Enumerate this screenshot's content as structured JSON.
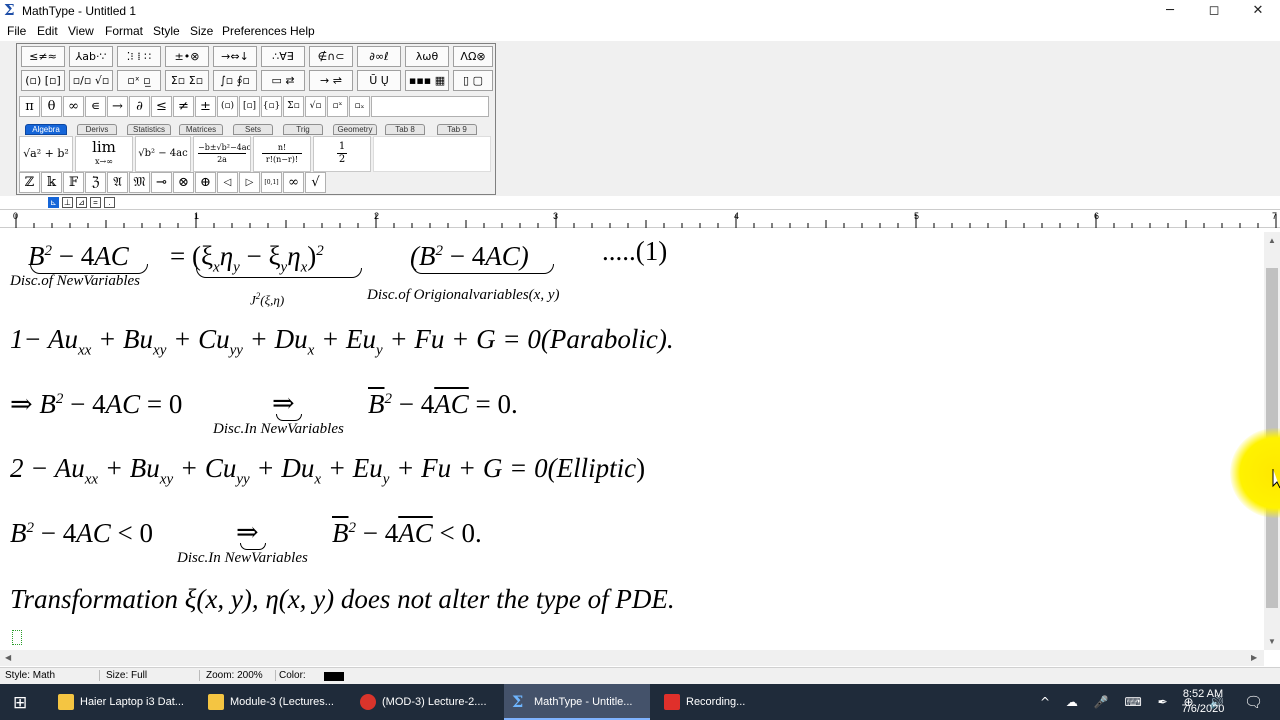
{
  "window": {
    "title": "MathType - Untitled 1",
    "icon": "Σ",
    "minimize": "─",
    "maximize": "◻",
    "close": "✕"
  },
  "menu": [
    "File",
    "Edit",
    "View",
    "Format",
    "Style",
    "Size",
    "Preferences",
    "Help"
  ],
  "palette": {
    "row1": [
      "≤≠≈",
      "⅄ab·∵",
      "⁚⁝ ⁞ ∷",
      "±•⊗",
      "→⇔↓",
      "∴∀∃",
      "∉∩⊂",
      "∂∞ℓ",
      "λωθ",
      "ΛΩ⊗"
    ],
    "row2": [
      "(▫) [▫]",
      "▫/▫ √▫",
      "▫ˣ ▫̲",
      "Σ▫ Σ▫",
      "∫▫ ∮▫",
      "▭ ⇄",
      "→ ⇌",
      "Ū Ų",
      "▪▪▪ ▦",
      "▯ ▢"
    ],
    "row3": [
      "π",
      "θ",
      "∞",
      "∊",
      "→",
      "∂",
      "≤",
      "≠",
      "±",
      "(▫)",
      "[▫]",
      "{▫}",
      "Σ▫",
      "√▫",
      "▫ˣ",
      "▫ₓ"
    ],
    "tabs": [
      "Algebra",
      "Derivs",
      "Statistics",
      "Matrices",
      "Sets",
      "Trig",
      "Geometry",
      "Tab 8",
      "Tab 9"
    ],
    "expr1": "√a² + b²",
    "expr2_top": "lim",
    "expr2_bottom": "x→∞",
    "expr3": "√b² − 4ac",
    "expr4_num": "−b±√b²−4ac",
    "expr4_den": "2a",
    "expr5_num": "n!",
    "expr5_den": "r!(n−r)!",
    "expr6_num": "1",
    "expr6_den": "2",
    "row5": [
      "ℤ",
      "𝕜",
      "𝔽",
      "ℨ",
      "𝔄",
      "𝔐",
      "⊸",
      "⊗",
      "⊕",
      "◁",
      "▷",
      "[0,1]",
      "∞",
      "√"
    ]
  },
  "ruler": [
    "0",
    "1",
    "2",
    "3",
    "4",
    "5",
    "6",
    "7"
  ],
  "equations": {
    "line1_left_a": "B",
    "line1_left_b": " − 4",
    "line1_left_c": "AC",
    "line1_mid": "= (ξ",
    "line1_mid2": "x",
    "line1_mid3": "η",
    "line1_mid4": "y",
    "line1_mid5": " − ξ",
    "line1_mid6": "y",
    "line1_mid7": "η",
    "line1_mid8": "x",
    "line1_mid9": ")",
    "line1_sq": "2",
    "line1_right": "(B",
    "line1_right_sq": "2",
    "line1_right2": " − 4",
    "line1_right3": "AC)",
    "line1_num": ".....(1)",
    "note1": "Disc.of NewVariables",
    "note2": "J",
    "note2_sq": "2",
    "note2b": "(ξ,η)",
    "note3": "Disc.of Origionalvariables(x, y)",
    "line2": "1− Au",
    "line2_s1": "xx",
    "line2_b": " + Bu",
    "line2_s2": "xy",
    "line2_c": " + Cu",
    "line2_s3": "yy",
    "line2_d": " + Du",
    "line2_s4": "x",
    "line2_e": " + Eu",
    "line2_s5": "y",
    "line2_f": " + Fu + G = 0(",
    "line2_g": "Parabolic",
    "line2_h": ").",
    "line3_a": "⇒ B",
    "line3_sq": "2",
    "line3_b": " − 4",
    "line3_c": "AC",
    "line3_d": " = 0",
    "line3_imp": "⇒",
    "line3_e": "B",
    "line3_sq2": "2",
    "line3_f": " − 4",
    "line3_g": "AC",
    "line3_h": " = 0.",
    "note4": "Disc.In NewVariables",
    "line4": "2 − Au",
    "line4_s1": "xx",
    "line4_b": " + Bu",
    "line4_s2": "xy",
    "line4_c": " + Cu",
    "line4_s3": "yy",
    "line4_d": " + Du",
    "line4_s4": "x",
    "line4_e": " + Eu",
    "line4_s5": "y",
    "line4_f": " + Fu + G = 0(",
    "line4_g": "Elliptic",
    "line4_h": ")",
    "line5_a": "B",
    "line5_sq": "2",
    "line5_b": " − 4",
    "line5_c": "AC",
    "line5_d": " < 0",
    "line5_imp": "⇒",
    "line5_e": "B",
    "line5_sq2": "2",
    "line5_f": " − 4",
    "line5_g": "AC",
    "line5_h": " < 0.",
    "note5": "Disc.In NewVariables",
    "line6_a": "Transformation ξ(x, y), η(x, y) does not alter the type of  PDE."
  },
  "status": {
    "style": "Style: Math",
    "size": "Size: Full",
    "zoom": "Zoom: 200%",
    "color": "Color:",
    "color_value": "#000000"
  },
  "taskbar": {
    "items": [
      "Haier Laptop i3 Dat...",
      "Module-3 (Lectures...",
      "(MOD-3) Lecture-2....",
      "MathType - Untitle...",
      "Recording..."
    ],
    "time": "8:52 AM",
    "date": "7/6/2020",
    "tray": "^ ☁ 🎤 ⌨ ✒ ⊕ 🔊"
  }
}
